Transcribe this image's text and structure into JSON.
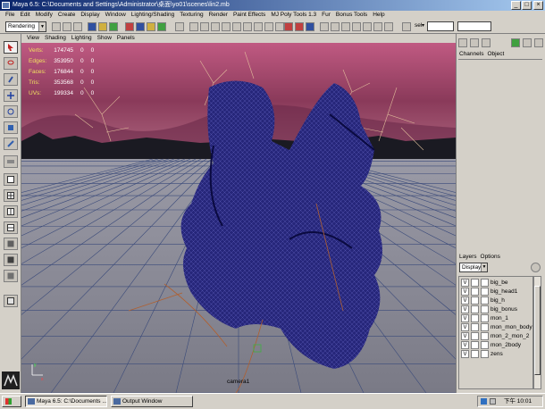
{
  "window": {
    "title": "Maya 6.5: C:\\Documents and Settings\\Administrator\\桌面\\yo01\\scenes\\lin2.mb",
    "min_glyph": "_",
    "max_glyph": "□",
    "close_glyph": "×"
  },
  "menubar": {
    "items": [
      "File",
      "Edit",
      "Modify",
      "Create",
      "Display",
      "Window",
      "Lighting/Shading",
      "Texturing",
      "Render",
      "Paint Effects",
      "MJ Poly Tools 1.3",
      "Fur",
      "Bonus Tools",
      "Help"
    ]
  },
  "statusline": {
    "mode": "Rendering",
    "mode_arrow": "▼",
    "sel_label": "sel",
    "sel_arrow": "▾"
  },
  "panel_menu": {
    "items": [
      "View",
      "Shading",
      "Lighting",
      "Show",
      "Panels"
    ]
  },
  "hud": {
    "rows": [
      {
        "label": "Verts:",
        "values": [
          "174745",
          "0",
          "0"
        ]
      },
      {
        "label": "Edges:",
        "values": [
          "353950",
          "0",
          "0"
        ]
      },
      {
        "label": "Faces:",
        "values": [
          "176844",
          "0",
          "0"
        ]
      },
      {
        "label": "Tris:",
        "values": [
          "353568",
          "0",
          "0"
        ]
      },
      {
        "label": "UVs:",
        "values": [
          "199334",
          "0",
          "0"
        ]
      }
    ]
  },
  "viewport": {
    "camera_label": "camera1"
  },
  "channel_box": {
    "tabs": [
      "Channels",
      "Object"
    ]
  },
  "layer_editor": {
    "menu": [
      "Layers",
      "Options"
    ],
    "display_mode": "Display",
    "display_arrow": "▼",
    "visible_glyph": "V",
    "layers": [
      "big_be",
      "big_head1",
      "big_h",
      "big_bonus",
      "mon_1",
      "mon_mon_body",
      "mon_2_mon_2",
      "mon_2body",
      "zens"
    ]
  },
  "taskbar": {
    "buttons": [
      {
        "label": "Maya 6.5: C:\\Documents ..."
      },
      {
        "label": "Output Window"
      }
    ],
    "clock": "下午 10:01"
  },
  "colors": {
    "title_start": "#0a246a",
    "title_end": "#a6caf0",
    "mesh": "#1a1a6e",
    "grid": "#3a4a7a",
    "sky": "#a04a6a",
    "hud_label": "#f0e060"
  }
}
